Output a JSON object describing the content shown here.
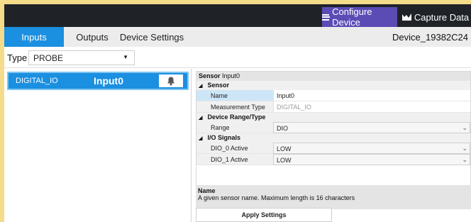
{
  "header": {
    "configure_label": "Configure Device",
    "capture_label": "Capture Data",
    "configure_icon": "list-icon",
    "capture_icon": "chart-icon"
  },
  "tabs": [
    {
      "label": "Inputs",
      "active": true
    },
    {
      "label": "Outputs",
      "active": false
    },
    {
      "label": "Device Settings",
      "active": false
    }
  ],
  "device_id": "Device_19382C24",
  "type_selector": {
    "label": "Type",
    "value": "PROBE"
  },
  "inputs_list": [
    {
      "type": "DIGITAL_IO",
      "name": "Input0",
      "icon": "bell-icon"
    }
  ],
  "property_grid": {
    "header_label": "Sensor",
    "header_value": "Input0",
    "categories": [
      {
        "name": "Sensor",
        "props": [
          {
            "name": "Name",
            "value": "Input0"
          },
          {
            "name": "Measurement Type",
            "value": "DIGITAL_IO"
          }
        ]
      },
      {
        "name": "Device Range/Type",
        "props": [
          {
            "name": "Range",
            "value": "DIO"
          }
        ]
      },
      {
        "name": "I/O Signals",
        "props": [
          {
            "name": "DIO_0 Active",
            "value": "LOW"
          },
          {
            "name": "DIO_1 Active",
            "value": "LOW"
          }
        ]
      }
    ]
  },
  "description": {
    "title": "Name",
    "text": "A given sensor name. Maximum length is 16 characters"
  },
  "apply_label": "Apply Settings",
  "colors": {
    "accent": "#1b8fe0",
    "configure_bg": "#5a4bb5",
    "topbar_bg": "#1f2328",
    "page_bg": "#f5dc8a"
  }
}
